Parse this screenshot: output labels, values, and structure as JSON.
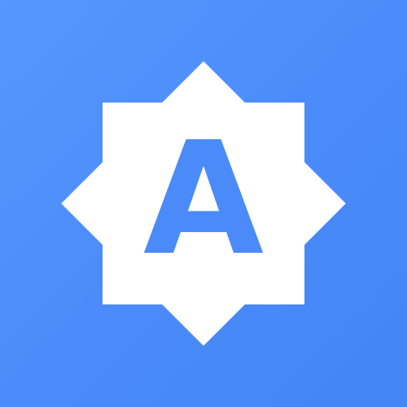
{
  "icon": {
    "letter": "A",
    "shape": "eight-point-star-badge",
    "colors": {
      "background": "#4a8bf9",
      "badge": "#ffffff",
      "letter": "#4a8bf9"
    }
  }
}
